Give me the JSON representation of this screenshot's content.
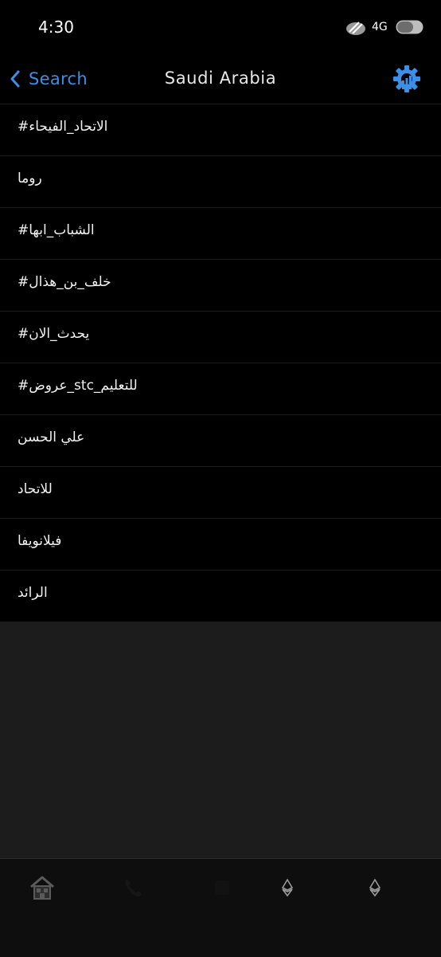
{
  "status_bar": {
    "time": "4:30",
    "network": "4G",
    "icons": [
      "signal-icon",
      "battery-icon"
    ]
  },
  "nav": {
    "back_label": "Search",
    "title": "Saudi Arabia",
    "icons": [
      "chevron-left-icon",
      "gear-icon"
    ],
    "accent_color": "#3b8fe6"
  },
  "trends": [
    {
      "label": "#الاتحاد_الفيحاء"
    },
    {
      "label": "روما"
    },
    {
      "label": "#الشباب_ابها"
    },
    {
      "label": "#خلف_بن_هذال"
    },
    {
      "label": "#يحدث_الان"
    },
    {
      "label": "#عروض_stc_للتعليم"
    },
    {
      "label": "علي الحسن"
    },
    {
      "label": "للاتحاد"
    },
    {
      "label": "فيلانويفا"
    },
    {
      "label": "الرائد"
    }
  ],
  "tab_bar": {
    "tabs": [
      {
        "icon": "home-icon",
        "active": true
      },
      {
        "icon": "phone-icon",
        "active": false
      },
      {
        "icon": "blank-tab-icon",
        "active": false
      },
      {
        "icon": "ethereum-icon",
        "active": false
      },
      {
        "icon": "ethereum-icon",
        "active": false
      }
    ]
  }
}
